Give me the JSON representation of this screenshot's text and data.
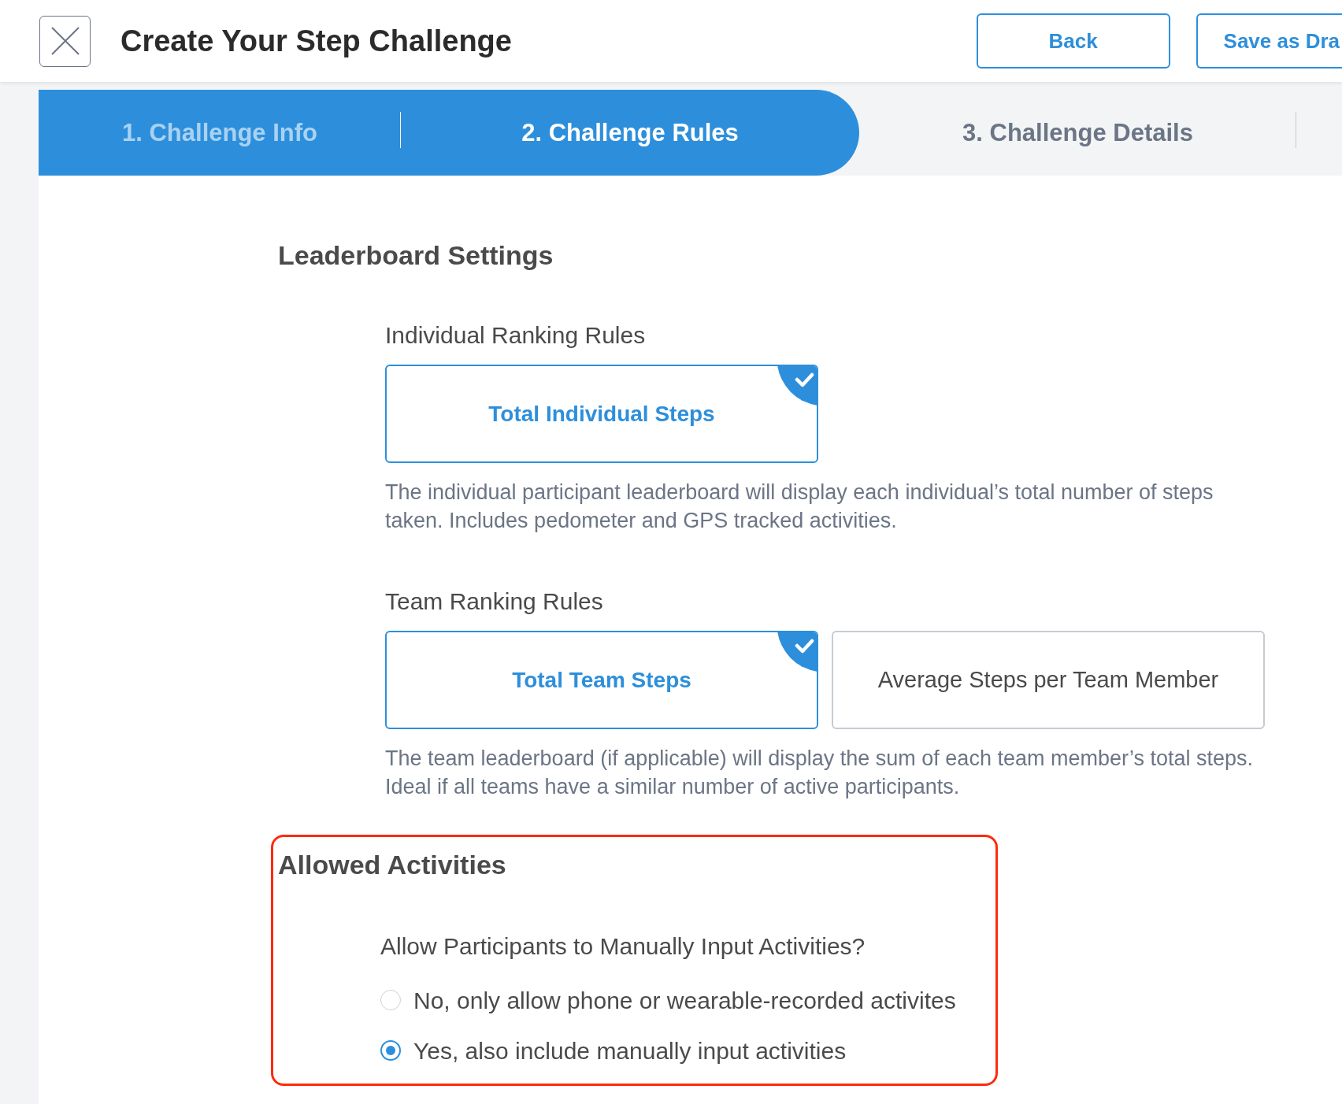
{
  "header": {
    "title": "Create Your Step Challenge",
    "buttons": [
      {
        "label": "Back"
      },
      {
        "label": "Save as Dra"
      }
    ]
  },
  "steps": [
    {
      "label": "1. Challenge Info",
      "selected": false,
      "completed": true
    },
    {
      "label": "2. Challenge Rules",
      "selected": true,
      "completed": false
    },
    {
      "label": "3. Challenge Details",
      "selected": false,
      "completed": false
    }
  ],
  "leaderboard_settings": {
    "title": "Leaderboard Settings",
    "groups": [
      {
        "label": "Individual Ranking Rules",
        "options": [
          {
            "label": "Total Individual Steps",
            "selected": true
          }
        ],
        "description": "The individual participant leaderboard will display each individual’s total number of steps taken. Includes pedometer and GPS tracked activities."
      },
      {
        "label": "Team Ranking Rules",
        "options": [
          {
            "label": "Total Team Steps",
            "selected": true
          },
          {
            "label": "Average Steps per Team Member",
            "selected": false
          }
        ],
        "description": "The team leaderboard (if applicable) will display the sum of each team member’s total steps. Ideal if all teams have a similar number of active participants."
      }
    ]
  },
  "allowed_activities": {
    "title": "Allowed Activities",
    "highlighted": true,
    "question": "Allow Participants to Manually Input Activities?",
    "options": [
      {
        "label": "No, only allow phone or wearable-recorded activites",
        "selected": false
      },
      {
        "label": "Yes, also include manually input activities",
        "selected": true
      }
    ]
  }
}
